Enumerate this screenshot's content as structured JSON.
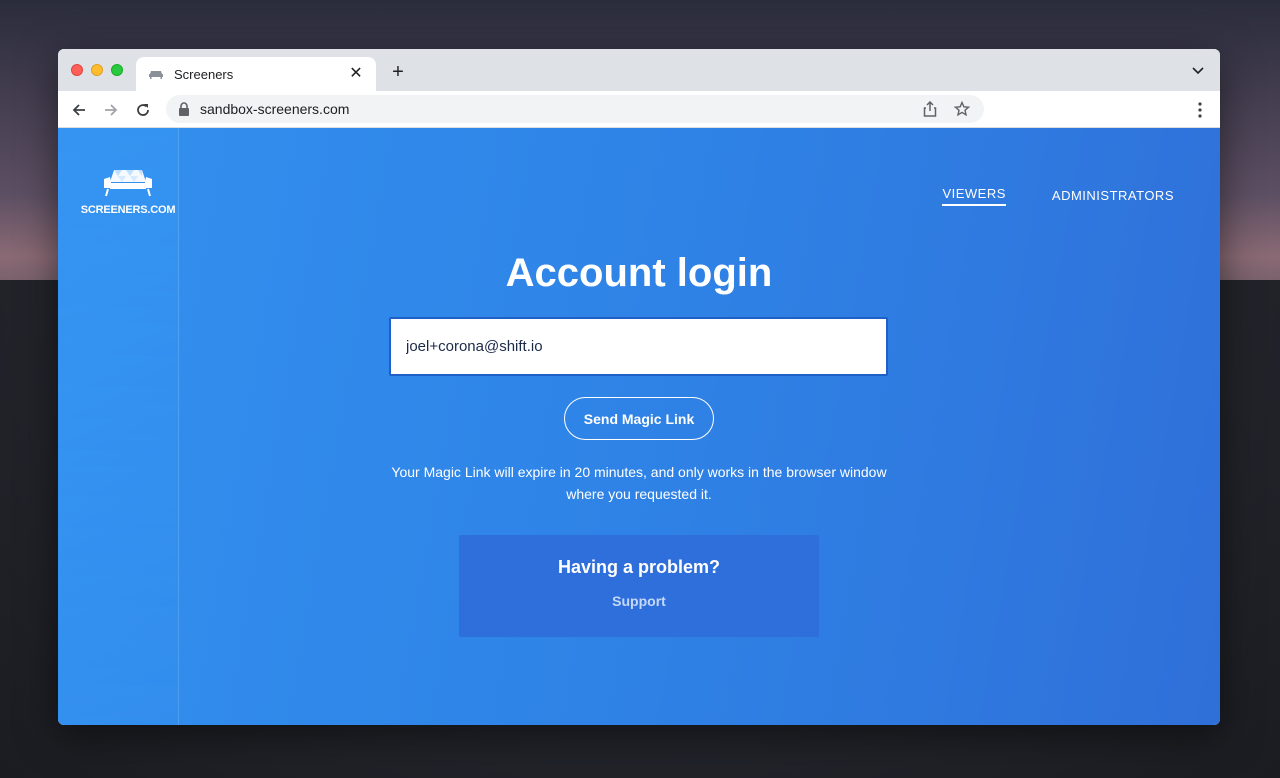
{
  "browser": {
    "tab_title": "Screeners",
    "tab_close_glyph": "✕",
    "new_tab_glyph": "+",
    "url": "sandbox-screeners.com"
  },
  "site": {
    "logo_text": "SCREENERS.COM",
    "nav": [
      {
        "label": "VIEWERS",
        "active": true
      },
      {
        "label": "ADMINISTRATORS",
        "active": false
      }
    ]
  },
  "login": {
    "title": "Account login",
    "email_value": "joel+corona@shift.io",
    "send_button": "Send Magic Link",
    "note": "Your Magic Link will expire in 20 minutes, and only works in the browser window where you requested it.",
    "problem_title": "Having a problem?",
    "support_link": "Support"
  },
  "colors": {
    "page_gradient_start": "#3390ef",
    "page_gradient_end": "#2f6fd8",
    "problem_box": "#2f6fdc",
    "input_border": "#1f5fc8"
  }
}
